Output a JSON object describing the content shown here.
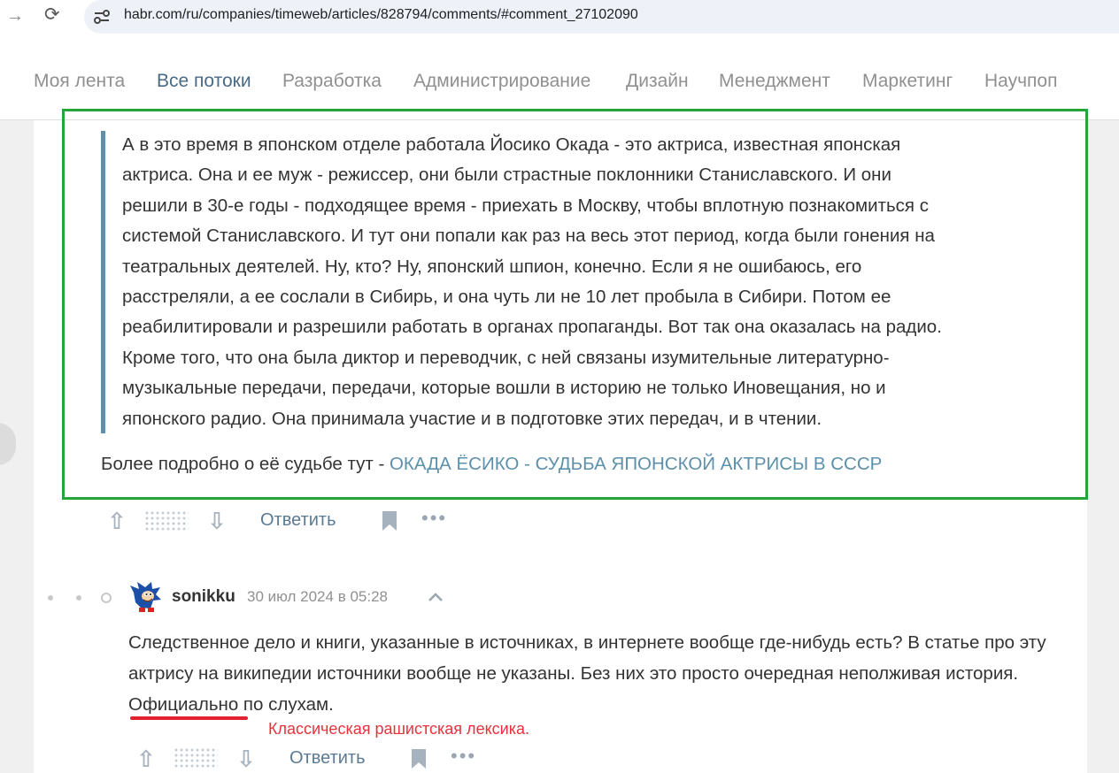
{
  "browser": {
    "url": "habr.com/ru/companies/timeweb/articles/828794/comments/#comment_27102090"
  },
  "nav": {
    "items": [
      "Моя лента",
      "Все потоки",
      "Разработка",
      "Администрирование",
      "Дизайн",
      "Менеджмент",
      "Маркетинг",
      "Научпоп"
    ],
    "active": "Все потоки"
  },
  "quote": {
    "text": "А в это время в японском отделе работала Йосико Окада - это актриса, известная японская\nактриса. Она и ее муж - режиссер, они были страстные поклонники Станиславского. И они\nрешили в 30-е годы - подходящее время - приехать в Москву, чтобы вплотную познакомиться с\nсистемой Станиславского. И тут они попали как раз на весь этот период, когда были гонения на\nтеатральных деятелей. Ну, кто? Ну, японский шпион, конечно. Если я не ошибаюсь, его\nрасстреляли, а ее сослали в Сибирь, и она чуть ли не 10 лет пробыла в Сибири. Потом ее\nреабилитировали и разрешили работать в органах пропаганды. Вот так она оказалась на радио.\nКроме того, что она была диктор и переводчик, с ней связаны изумительные литературно-\nмузыкальные передачи, передачи, которые вошли в историю не только Иновещания, но и\nяпонского радио. Она принимала участие и в подготовке этих передач, и в чтении."
  },
  "more": {
    "prefix": "Более подробно о её судьбе тут - ",
    "link": "ОКАДА ЁСИКО - СУДЬБА ЯПОНСКОЙ АКТРИСЫ В СССР"
  },
  "actions": {
    "reply_label": "Ответить"
  },
  "comment": {
    "username": "sonikku",
    "date": "30 июл 2024 в 05:28",
    "text_before": "Следственное дело и книги, указанные в источниках, в интернете вообще где-нибудь есть? В статье про эту актрису на википедии источники вообще не указаны. Без них это просто очередная ",
    "underlined_word": "неполживая",
    "text_after": " история. Официально по слухам."
  },
  "annotation": {
    "text": "Классическая рашистская лексика."
  },
  "colors": {
    "highlight_border": "#22a539",
    "annotation_red": "#e8313b",
    "link": "#5c90ab"
  }
}
